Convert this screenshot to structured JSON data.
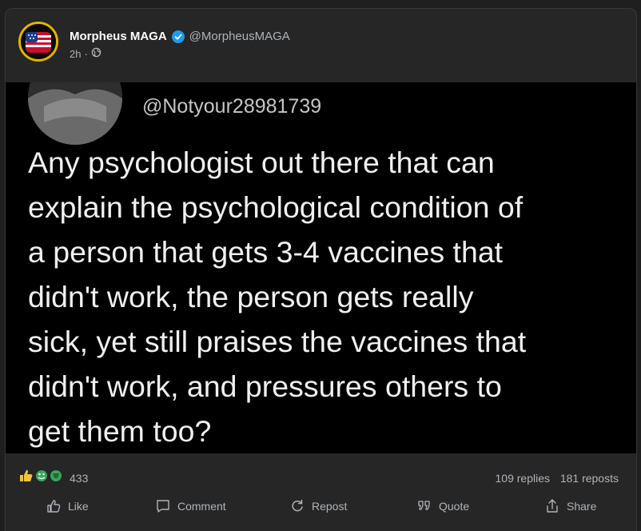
{
  "post": {
    "author_name": "Morpheus MAGA",
    "author_handle": "@MorpheusMAGA",
    "time": "2h",
    "separator": "·"
  },
  "quoted": {
    "handle": "@Notyour28981739",
    "lines": [
      "Any psychologist out there that can",
      "explain the psychological condition of",
      "a person that gets 3-4 vaccines that",
      "didn't work, the person gets really",
      "sick, yet still praises the vaccines that",
      "didn't work, and pressures others to",
      "get them too?"
    ]
  },
  "stats": {
    "reaction_count": "433",
    "replies": "109 replies",
    "reposts": "181 reposts"
  },
  "actions": {
    "like": "Like",
    "comment": "Comment",
    "repost": "Repost",
    "quote": "Quote",
    "share": "Share"
  },
  "colors": {
    "verified": "#1d9bf0",
    "avatar_ring": "#e2b400"
  }
}
